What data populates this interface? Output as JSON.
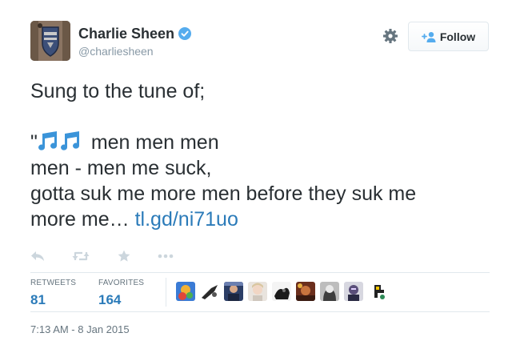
{
  "user": {
    "display_name": "Charlie Sheen",
    "handle": "@charliesheen",
    "verified": true,
    "avatar_icon": "avatar"
  },
  "follow_button": {
    "label": "Follow",
    "icon": "follow-user-icon"
  },
  "settings_icon": "gear-icon",
  "tweet": {
    "line1": "Sung to the tune of;",
    "line2_quote": "\"",
    "line2_emoji": "music-notes-icon",
    "line2_text": " men men men",
    "line3": "men - men me suck,",
    "line4": "gotta suk me more men before they suk me",
    "line5_text": "more me… ",
    "line5_link": "tl.gd/ni71uo"
  },
  "actions": [
    "reply-icon",
    "retweet-icon",
    "favorite-icon",
    "more-icon"
  ],
  "stats": {
    "retweets_label": "RETWEETS",
    "retweets_value": "81",
    "favorites_label": "FAVORITES",
    "favorites_value": "164"
  },
  "favoriters_count_shown": 10,
  "timestamp": "7:13 AM - 8 Jan 2015",
  "colors": {
    "link": "#2b7bb9",
    "text": "#292f33",
    "muted": "#8899a6",
    "verified": "#55acee",
    "emoji": "#3b94d9"
  }
}
